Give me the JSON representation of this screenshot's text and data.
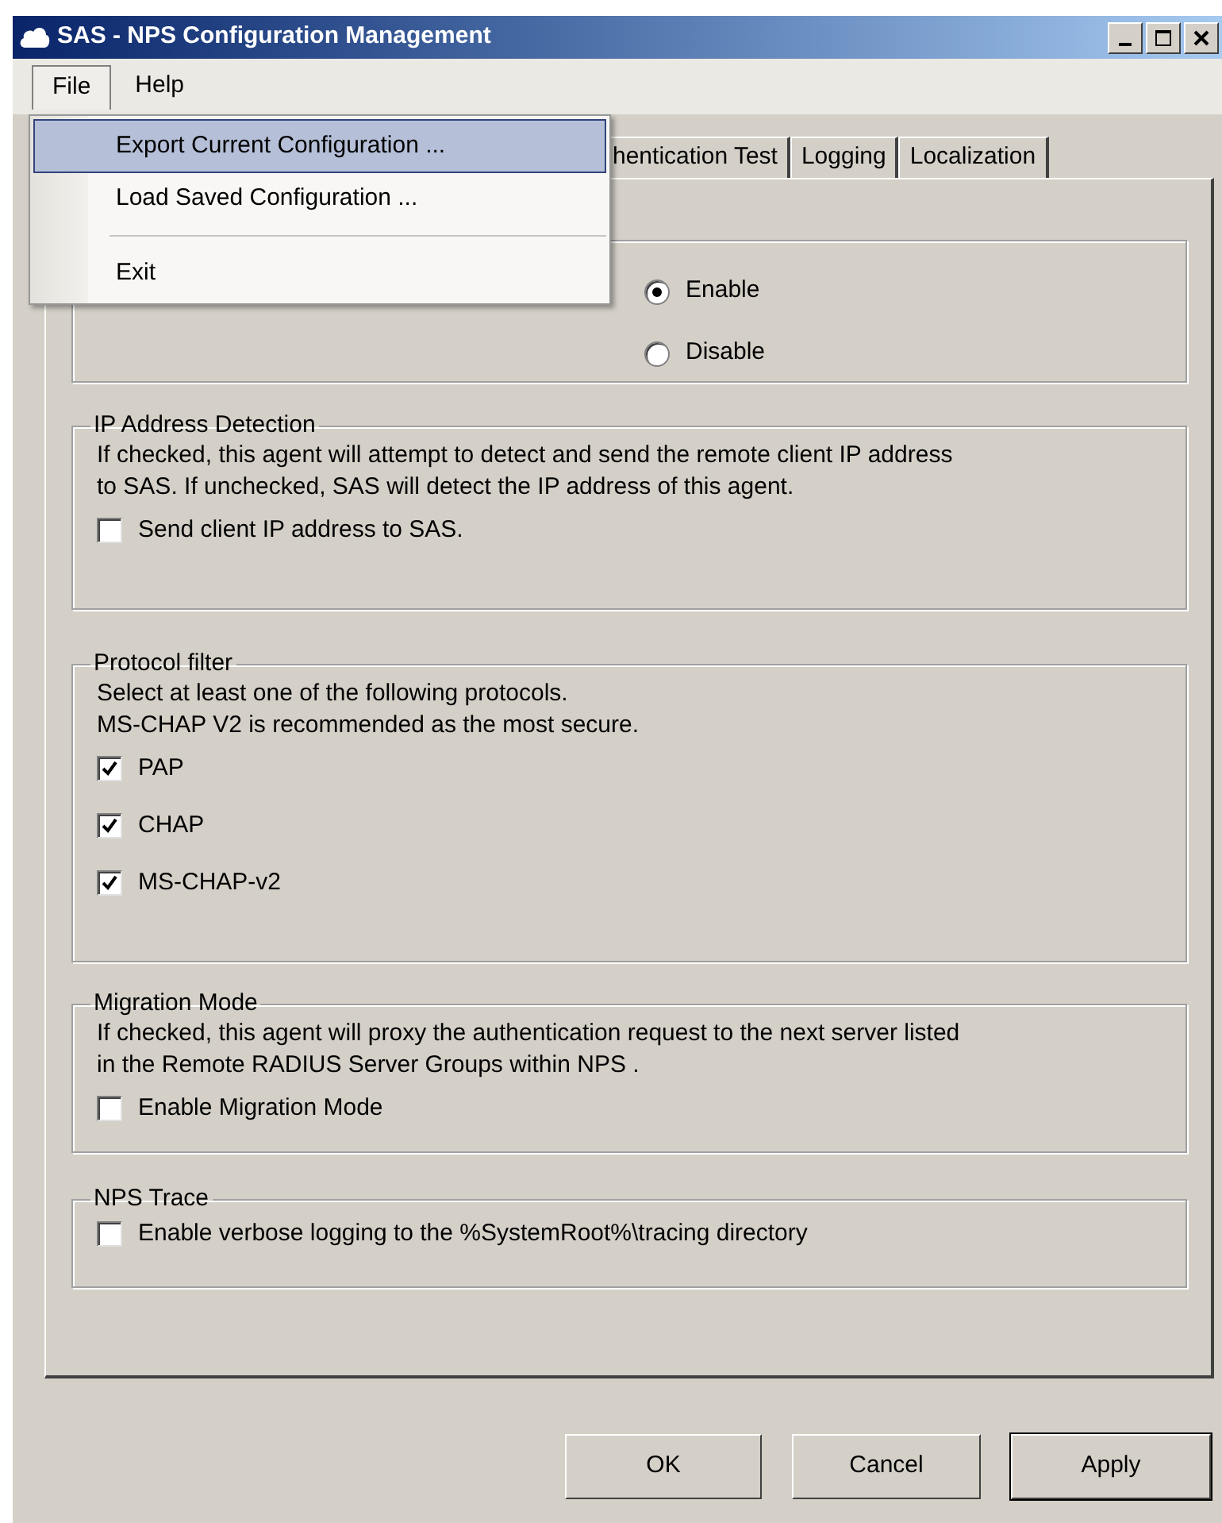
{
  "window": {
    "title": "SAS - NPS Configuration Management"
  },
  "menu_bar": [
    {
      "label": "File",
      "selected": true
    },
    {
      "label": "Help",
      "selected": false
    }
  ],
  "file_menu": {
    "items": [
      {
        "kind": "item",
        "label": "Export Current Configuration ...",
        "selected": true
      },
      {
        "kind": "item",
        "label": "Load Saved Configuration ...",
        "selected": false
      },
      {
        "kind": "separator"
      },
      {
        "kind": "item",
        "label": "Exit",
        "selected": false
      }
    ]
  },
  "tabs": [
    {
      "label": "hentication Test",
      "selected": false
    },
    {
      "label": "Logging",
      "selected": false
    },
    {
      "label": "Localization",
      "selected": false
    }
  ],
  "groups": [
    {
      "controls": [
        {
          "kind": "radio",
          "label": "Enable",
          "checked": true
        },
        {
          "kind": "radio",
          "label": "Disable",
          "checked": false
        }
      ]
    },
    {
      "title": "IP Address Detection",
      "description": "If checked, this agent will attempt to detect and send the remote client IP address\nto SAS.  If unchecked, SAS will detect the IP address of this agent.",
      "controls": [
        {
          "kind": "checkbox",
          "label": "Send client IP address to SAS.",
          "checked": false
        }
      ]
    },
    {
      "title": "Protocol filter",
      "description": "Select at least one of the following protocols.\nMS-CHAP V2 is recommended as the most secure.",
      "controls": [
        {
          "kind": "checkbox",
          "label": "PAP",
          "checked": true
        },
        {
          "kind": "checkbox",
          "label": "CHAP",
          "checked": true
        },
        {
          "kind": "checkbox",
          "label": "MS-CHAP-v2",
          "checked": true
        }
      ]
    },
    {
      "title": "Migration Mode",
      "description": "If checked, this agent will proxy the authentication request to the next server listed\nin the Remote RADIUS Server Groups within NPS .",
      "controls": [
        {
          "kind": "checkbox",
          "label": "Enable Migration Mode",
          "checked": false
        }
      ]
    },
    {
      "title": "NPS Trace",
      "controls": [
        {
          "kind": "checkbox",
          "label": "Enable verbose logging to the %SystemRoot%\\tracing directory",
          "checked": false
        }
      ]
    }
  ],
  "buttons": [
    {
      "label": "OK",
      "default": false
    },
    {
      "label": "Cancel",
      "default": false
    },
    {
      "label": "Apply",
      "default": true
    }
  ]
}
